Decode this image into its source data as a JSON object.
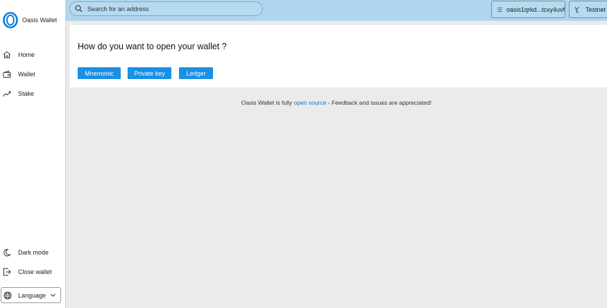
{
  "app": {
    "name": "Oasis Wallet"
  },
  "sidebar": {
    "items": [
      {
        "label": "Home",
        "icon": "home-icon"
      },
      {
        "label": "Wallet",
        "icon": "wallet-icon"
      },
      {
        "label": "Stake",
        "icon": "chart-line-icon"
      }
    ],
    "dark_mode": "Dark mode",
    "close_wallet": "Close wallet",
    "language": "Language"
  },
  "header": {
    "search_placeholder": "Search for an address",
    "account": "oasis1qrkd...tcxy4uvf",
    "network": "Testnet"
  },
  "main": {
    "title": "How do you want to open your wallet ?",
    "buttons": {
      "mnemonic": "Mnemonic",
      "private_key": "Private key",
      "ledger": "Ledger"
    }
  },
  "footer": {
    "prefix": "Oasis Wallet is fully ",
    "link": "open source",
    "suffix": " - Feedback and issues are appreciated!"
  },
  "colors": {
    "header_bg": "#aed6ee",
    "accent": "#1a8fe3",
    "link": "#0e74c4",
    "page_bg": "#ebebeb"
  }
}
